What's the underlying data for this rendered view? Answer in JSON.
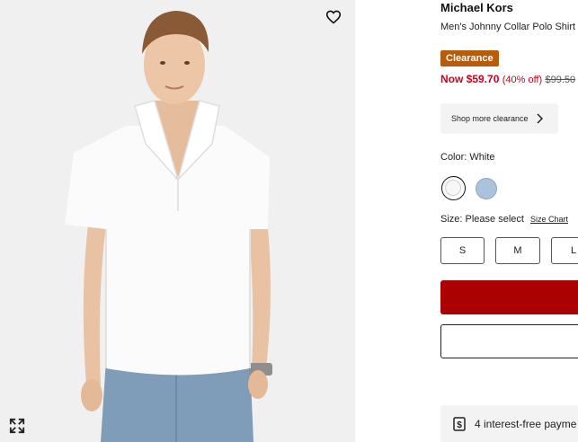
{
  "product": {
    "brand": "Michael Kors",
    "name": "Men's Johnny Collar Polo Shirt",
    "badge": "Clearance",
    "price_now": "Now $59.70",
    "discount": "(40% off)",
    "price_was": "$99.50"
  },
  "shop_more": {
    "label": "Shop more clearance"
  },
  "color": {
    "label": "Color:",
    "selected": "White",
    "options": [
      "White",
      "Light Blue"
    ]
  },
  "size": {
    "label": "Size:",
    "selected": "Please select",
    "chart_link": "Size Chart",
    "options": [
      "S",
      "M",
      "L"
    ]
  },
  "installments": {
    "text": "4 interest-free payme"
  },
  "colors": {
    "add_to_bag": "#ab0101",
    "price": "#d0021b",
    "badge": "#b85c0b"
  },
  "icons": {
    "wishlist": "heart-icon",
    "expand": "expand-icon",
    "chevron": "chevron-right-icon",
    "installments": "dollar-sign-icon"
  }
}
